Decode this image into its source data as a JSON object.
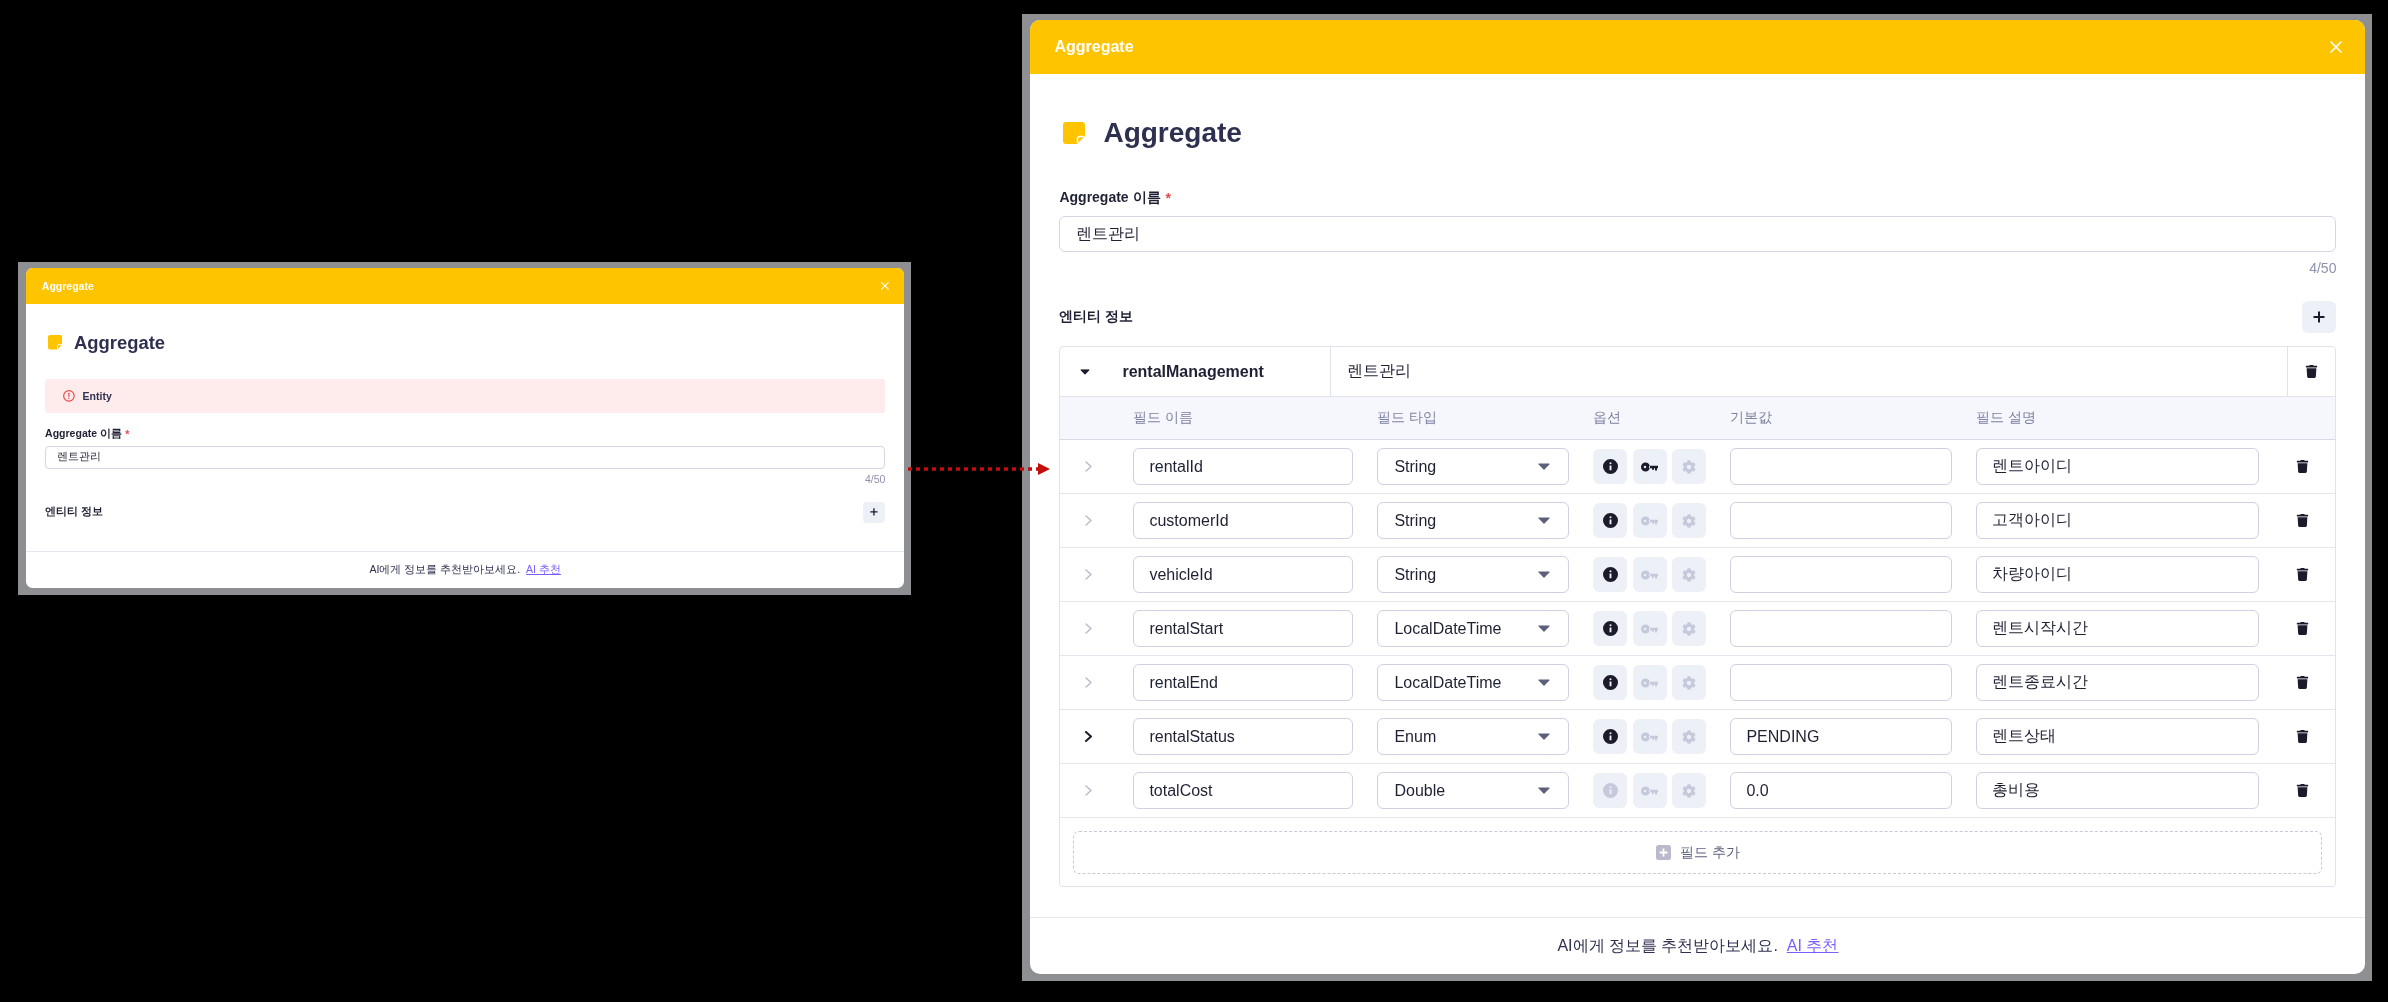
{
  "dialogs": [
    {
      "title": "Aggregate",
      "heading": "Aggregate",
      "alert": {
        "text": "Entity"
      },
      "name_field": {
        "label": "Aggregate 이름",
        "required_mark": "*",
        "value": "렌트관리",
        "counter": "4/50"
      },
      "entity_section": {
        "label": "엔티티 정보"
      },
      "footer": {
        "text": "AI에게 정보를 추천받아보세요.",
        "link": "AI 추천"
      }
    },
    {
      "title": "Aggregate",
      "heading": "Aggregate",
      "name_field": {
        "label": "Aggregate 이름",
        "required_mark": "*",
        "value": "렌트관리",
        "counter": "4/50"
      },
      "entity_section": {
        "label": "엔티티 정보",
        "entities": [
          {
            "name": "rentalManagement",
            "label": "렌트관리",
            "expanded": true,
            "columns": [
              "필드 이름",
              "필드 타입",
              "옵션",
              "기본값",
              "필드 설명"
            ],
            "fields": [
              {
                "name": "rentalId",
                "type": "String",
                "description": "렌트아이디",
                "expandable": false,
                "options": [
                  {
                    "kind": "info",
                    "on": true
                  },
                  {
                    "kind": "key",
                    "on": true
                  },
                  {
                    "kind": "gear",
                    "on": false
                  }
                ]
              },
              {
                "name": "customerId",
                "type": "String",
                "description": "고객아이디",
                "expandable": false,
                "options": [
                  {
                    "kind": "info",
                    "on": true
                  },
                  {
                    "kind": "key",
                    "on": false
                  },
                  {
                    "kind": "gear",
                    "on": false
                  }
                ]
              },
              {
                "name": "vehicleId",
                "type": "String",
                "description": "차량아이디",
                "expandable": false,
                "options": [
                  {
                    "kind": "info",
                    "on": true
                  },
                  {
                    "kind": "key",
                    "on": false
                  },
                  {
                    "kind": "gear",
                    "on": false
                  }
                ]
              },
              {
                "name": "rentalStart",
                "type": "LocalDateTime",
                "description": "렌트시작시간",
                "expandable": false,
                "options": [
                  {
                    "kind": "info",
                    "on": true
                  },
                  {
                    "kind": "key",
                    "on": false
                  },
                  {
                    "kind": "gear",
                    "on": false
                  }
                ]
              },
              {
                "name": "rentalEnd",
                "type": "LocalDateTime",
                "description": "렌트종료시간",
                "expandable": false,
                "options": [
                  {
                    "kind": "info",
                    "on": true
                  },
                  {
                    "kind": "key",
                    "on": false
                  },
                  {
                    "kind": "gear",
                    "on": false
                  }
                ]
              },
              {
                "name": "rentalStatus",
                "type": "Enum",
                "default": "PENDING",
                "description": "렌트상태",
                "expandable": true,
                "options": [
                  {
                    "kind": "info",
                    "on": true
                  },
                  {
                    "kind": "key",
                    "on": false
                  },
                  {
                    "kind": "gear",
                    "on": false
                  }
                ]
              },
              {
                "name": "totalCost",
                "type": "Double",
                "default": "0.0",
                "description": "총비용",
                "expandable": false,
                "options": [
                  {
                    "kind": "info",
                    "on": false
                  },
                  {
                    "kind": "key",
                    "on": false
                  },
                  {
                    "kind": "gear",
                    "on": false
                  }
                ]
              }
            ],
            "add_field_button": "필드 추가"
          }
        ]
      },
      "footer": {
        "text": "AI에게 정보를 추천받아보세요.",
        "link": "AI 추천"
      }
    }
  ]
}
